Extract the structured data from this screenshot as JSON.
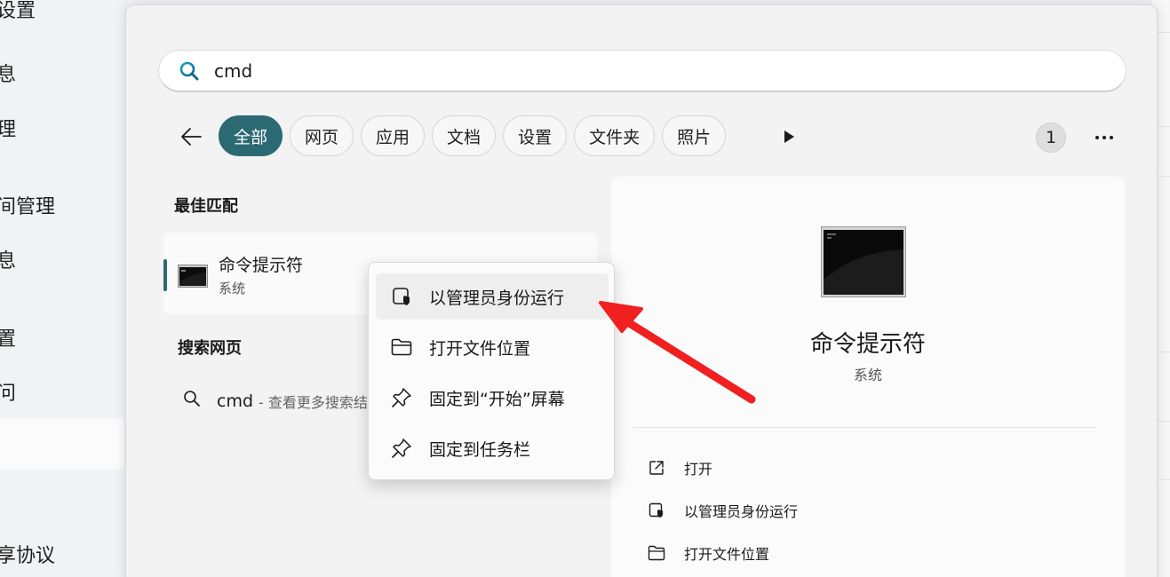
{
  "background_settings": {
    "items": [
      "设置",
      "息",
      "理",
      "间管理",
      "息",
      "置",
      "问",
      "享协议"
    ]
  },
  "search": {
    "query": "cmd",
    "icon": "search-icon"
  },
  "filters": {
    "back_icon": "arrow-left-icon",
    "chips": [
      "全部",
      "网页",
      "应用",
      "文档",
      "设置",
      "文件夹",
      "照片"
    ],
    "active_chip": "全部",
    "more_chips_icon": "play-icon",
    "result_count": "1",
    "more_icon": "ellipsis-icon"
  },
  "best_match": {
    "heading": "最佳匹配",
    "name": "命令提示符",
    "subtitle": "系统",
    "icon": "command-prompt-icon"
  },
  "web_search": {
    "heading": "搜索网页",
    "query": "cmd",
    "hint": "- 查看更多搜索结"
  },
  "context_menu": {
    "items": [
      {
        "label": "以管理员身份运行",
        "icon": "admin-shield-icon"
      },
      {
        "label": "打开文件位置",
        "icon": "folder-icon"
      },
      {
        "label": "固定到“开始”屏幕",
        "icon": "pin-icon"
      },
      {
        "label": "固定到任务栏",
        "icon": "pin-icon"
      }
    ]
  },
  "preview": {
    "title": "命令提示符",
    "subtitle": "系统",
    "actions": [
      {
        "label": "打开",
        "icon": "open-external-icon"
      },
      {
        "label": "以管理员身份运行",
        "icon": "admin-shield-icon"
      },
      {
        "label": "打开文件位置",
        "icon": "folder-icon"
      }
    ]
  },
  "colors": {
    "accent": "#2c6a73",
    "annotation_arrow": "#f02020"
  }
}
